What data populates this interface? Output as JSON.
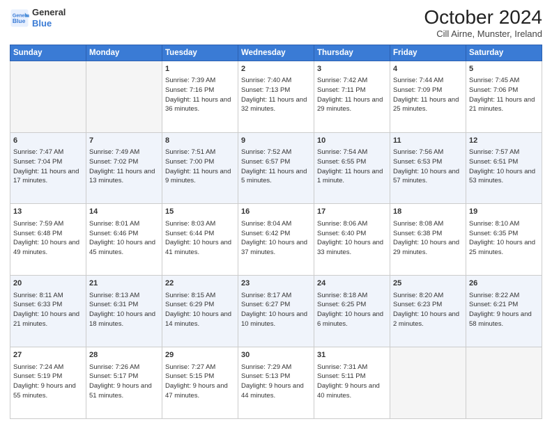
{
  "header": {
    "logo_line1": "General",
    "logo_line2": "Blue",
    "month": "October 2024",
    "location": "Cill Airne, Munster, Ireland"
  },
  "days_of_week": [
    "Sunday",
    "Monday",
    "Tuesday",
    "Wednesday",
    "Thursday",
    "Friday",
    "Saturday"
  ],
  "weeks": [
    [
      {
        "day": "",
        "detail": ""
      },
      {
        "day": "",
        "detail": ""
      },
      {
        "day": "1",
        "detail": "Sunrise: 7:39 AM\nSunset: 7:16 PM\nDaylight: 11 hours\nand 36 minutes."
      },
      {
        "day": "2",
        "detail": "Sunrise: 7:40 AM\nSunset: 7:13 PM\nDaylight: 11 hours\nand 32 minutes."
      },
      {
        "day": "3",
        "detail": "Sunrise: 7:42 AM\nSunset: 7:11 PM\nDaylight: 11 hours\nand 29 minutes."
      },
      {
        "day": "4",
        "detail": "Sunrise: 7:44 AM\nSunset: 7:09 PM\nDaylight: 11 hours\nand 25 minutes."
      },
      {
        "day": "5",
        "detail": "Sunrise: 7:45 AM\nSunset: 7:06 PM\nDaylight: 11 hours\nand 21 minutes."
      }
    ],
    [
      {
        "day": "6",
        "detail": "Sunrise: 7:47 AM\nSunset: 7:04 PM\nDaylight: 11 hours\nand 17 minutes."
      },
      {
        "day": "7",
        "detail": "Sunrise: 7:49 AM\nSunset: 7:02 PM\nDaylight: 11 hours\nand 13 minutes."
      },
      {
        "day": "8",
        "detail": "Sunrise: 7:51 AM\nSunset: 7:00 PM\nDaylight: 11 hours\nand 9 minutes."
      },
      {
        "day": "9",
        "detail": "Sunrise: 7:52 AM\nSunset: 6:57 PM\nDaylight: 11 hours\nand 5 minutes."
      },
      {
        "day": "10",
        "detail": "Sunrise: 7:54 AM\nSunset: 6:55 PM\nDaylight: 11 hours\nand 1 minute."
      },
      {
        "day": "11",
        "detail": "Sunrise: 7:56 AM\nSunset: 6:53 PM\nDaylight: 10 hours\nand 57 minutes."
      },
      {
        "day": "12",
        "detail": "Sunrise: 7:57 AM\nSunset: 6:51 PM\nDaylight: 10 hours\nand 53 minutes."
      }
    ],
    [
      {
        "day": "13",
        "detail": "Sunrise: 7:59 AM\nSunset: 6:48 PM\nDaylight: 10 hours\nand 49 minutes."
      },
      {
        "day": "14",
        "detail": "Sunrise: 8:01 AM\nSunset: 6:46 PM\nDaylight: 10 hours\nand 45 minutes."
      },
      {
        "day": "15",
        "detail": "Sunrise: 8:03 AM\nSunset: 6:44 PM\nDaylight: 10 hours\nand 41 minutes."
      },
      {
        "day": "16",
        "detail": "Sunrise: 8:04 AM\nSunset: 6:42 PM\nDaylight: 10 hours\nand 37 minutes."
      },
      {
        "day": "17",
        "detail": "Sunrise: 8:06 AM\nSunset: 6:40 PM\nDaylight: 10 hours\nand 33 minutes."
      },
      {
        "day": "18",
        "detail": "Sunrise: 8:08 AM\nSunset: 6:38 PM\nDaylight: 10 hours\nand 29 minutes."
      },
      {
        "day": "19",
        "detail": "Sunrise: 8:10 AM\nSunset: 6:35 PM\nDaylight: 10 hours\nand 25 minutes."
      }
    ],
    [
      {
        "day": "20",
        "detail": "Sunrise: 8:11 AM\nSunset: 6:33 PM\nDaylight: 10 hours\nand 21 minutes."
      },
      {
        "day": "21",
        "detail": "Sunrise: 8:13 AM\nSunset: 6:31 PM\nDaylight: 10 hours\nand 18 minutes."
      },
      {
        "day": "22",
        "detail": "Sunrise: 8:15 AM\nSunset: 6:29 PM\nDaylight: 10 hours\nand 14 minutes."
      },
      {
        "day": "23",
        "detail": "Sunrise: 8:17 AM\nSunset: 6:27 PM\nDaylight: 10 hours\nand 10 minutes."
      },
      {
        "day": "24",
        "detail": "Sunrise: 8:18 AM\nSunset: 6:25 PM\nDaylight: 10 hours\nand 6 minutes."
      },
      {
        "day": "25",
        "detail": "Sunrise: 8:20 AM\nSunset: 6:23 PM\nDaylight: 10 hours\nand 2 minutes."
      },
      {
        "day": "26",
        "detail": "Sunrise: 8:22 AM\nSunset: 6:21 PM\nDaylight: 9 hours\nand 58 minutes."
      }
    ],
    [
      {
        "day": "27",
        "detail": "Sunrise: 7:24 AM\nSunset: 5:19 PM\nDaylight: 9 hours\nand 55 minutes."
      },
      {
        "day": "28",
        "detail": "Sunrise: 7:26 AM\nSunset: 5:17 PM\nDaylight: 9 hours\nand 51 minutes."
      },
      {
        "day": "29",
        "detail": "Sunrise: 7:27 AM\nSunset: 5:15 PM\nDaylight: 9 hours\nand 47 minutes."
      },
      {
        "day": "30",
        "detail": "Sunrise: 7:29 AM\nSunset: 5:13 PM\nDaylight: 9 hours\nand 44 minutes."
      },
      {
        "day": "31",
        "detail": "Sunrise: 7:31 AM\nSunset: 5:11 PM\nDaylight: 9 hours\nand 40 minutes."
      },
      {
        "day": "",
        "detail": ""
      },
      {
        "day": "",
        "detail": ""
      }
    ]
  ]
}
